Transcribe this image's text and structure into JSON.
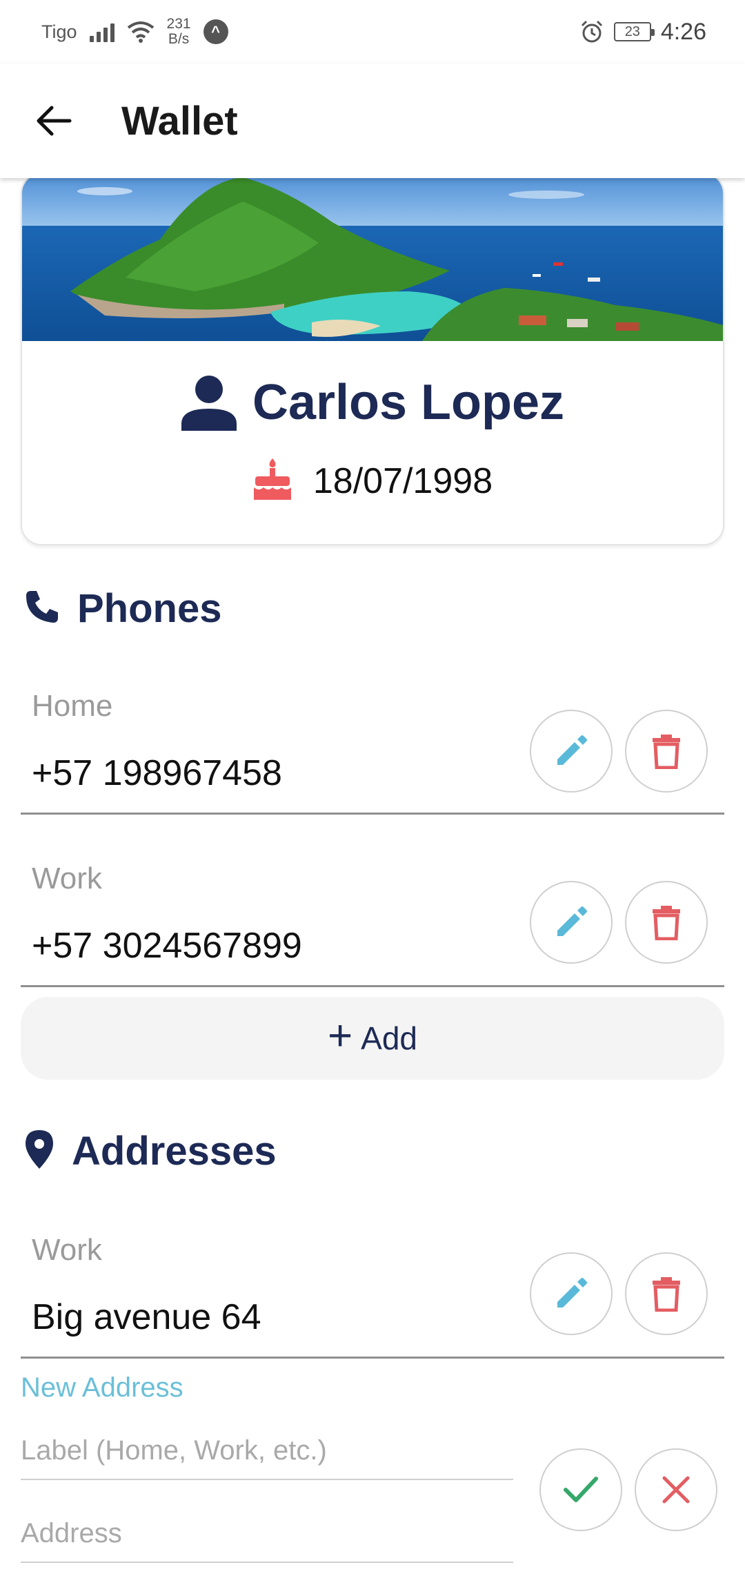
{
  "status_bar": {
    "carrier": "Tigo",
    "speed_value": "231",
    "speed_unit": "B/s",
    "battery": "23",
    "time": "4:26"
  },
  "app_bar": {
    "title": "Wallet",
    "back_icon": "arrow-left-icon"
  },
  "profile": {
    "name": "Carlos Lopez",
    "birthdate": "18/07/1998",
    "name_icon": "person-icon",
    "birth_icon": "cake-icon"
  },
  "phones": {
    "title": "Phones",
    "icon": "phone-icon",
    "items": [
      {
        "label": "Home",
        "value": "+57 198967458"
      },
      {
        "label": "Work",
        "value": "+57 3024567899"
      }
    ],
    "add_label": "Add"
  },
  "addresses": {
    "title": "Addresses",
    "icon": "map-pin-icon",
    "items": [
      {
        "label": "Work",
        "value": "Big avenue 64"
      }
    ]
  },
  "new_address": {
    "title": "New Address",
    "label_placeholder": "Label (Home, Work, etc.)",
    "address_placeholder": "Address"
  },
  "colors": {
    "navy": "#1d2a55",
    "edit": "#5ab9d9",
    "delete": "#e35d62",
    "confirm": "#35a86a",
    "cancel": "#e35d62",
    "accent_text": "#6bbfd8"
  }
}
